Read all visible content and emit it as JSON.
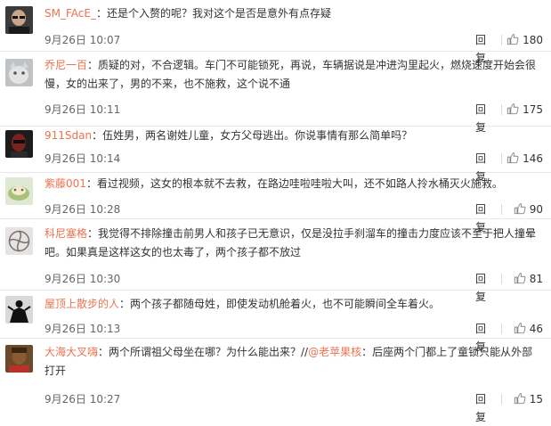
{
  "comments": [
    {
      "user": "SM_FAcE_",
      "text": "：还是个入赘的呢？我对这个是否是意外有点存疑",
      "time": "9月26日 10:07",
      "reply": "回复",
      "likes": "180",
      "avatar": "man-glasses"
    },
    {
      "user": "乔尼一百",
      "text": "：质疑的对，不合逻辑。车门不可能锁死，再说，车辆据说是冲进沟里起火，燃烧速度开始会很慢，女的出来了，男的不来，也不施救，这个说不通",
      "time": "9月26日 10:11",
      "reply": "回复",
      "likes": "175",
      "avatar": "cat"
    },
    {
      "user": "911Sdan",
      "text": "：伍姓男，两名谢姓儿童，女方父母逃出。你说事情有那么简单吗？",
      "time": "9月26日 10:14",
      "reply": "回复",
      "likes": "146",
      "avatar": "masked"
    },
    {
      "user": "紫藤001",
      "text": "：看过视频，这女的根本就不去救，在路边哇啦哇啦大叫，还不如路人拎水桶灭火施救。",
      "time": "9月26日 10:28",
      "reply": "回复",
      "likes": "90",
      "avatar": "green-food"
    },
    {
      "user": "科尼塞格",
      "text": "：我觉得不排除撞击前男人和孩子已无意识，仅是没拉手刹溜车的撞击力度应该不至于把人撞晕吧。如果真是这样这女的也太毒了，两个孩子都不放过",
      "time": "9月26日 10:30",
      "reply": "回复",
      "likes": "81",
      "avatar": "swirl"
    },
    {
      "user": "屋顶上散步的人",
      "text": "：两个孩子都随母姓，即使发动机舱着火，也不可能瞬间全车着火。",
      "time": "9月26日 10:13",
      "reply": "回复",
      "likes": "46",
      "avatar": "figure"
    },
    {
      "user": "大海大叉嗨",
      "text_pre": "：两个所谓祖父母坐在哪？为什么能出来？//",
      "mention": "@老苹果核",
      "text_post": "：后座两个门都上了童锁只能从外部打开",
      "time": "9月26日 10:27",
      "reply": "回复",
      "likes": "15",
      "avatar": "portrait"
    }
  ],
  "colors": {
    "username": "#eb7350",
    "text": "#333333",
    "time": "#666666",
    "divider": "#e8e8e8"
  },
  "icons": {
    "like": "thumbs-up-icon"
  }
}
